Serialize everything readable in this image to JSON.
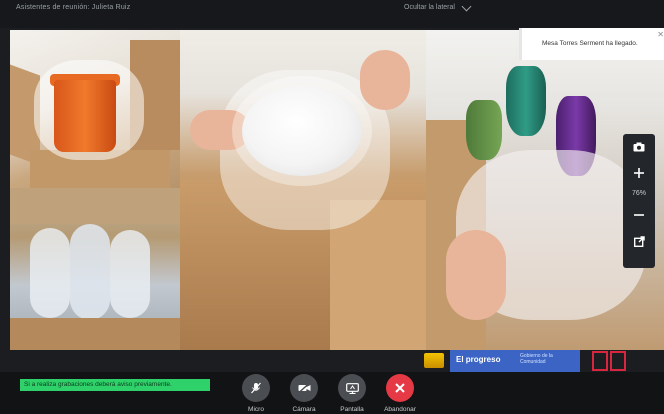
{
  "header": {
    "title": "Asistentes de reunión: Julieta Ruiz",
    "layout_label": "Ocultar la lateral"
  },
  "notification": {
    "message": "Mesa Torres Serment ha llegado."
  },
  "zoom": {
    "level": "76%"
  },
  "branding": {
    "badge_title": "El progreso",
    "badge_subtitle": "Gobierno de la Comunidad"
  },
  "status": {
    "notice": "Si a realiza grabaciones deberá aviso previamente."
  },
  "controls": [
    {
      "label": "Micro",
      "icon": "microphone-off-icon"
    },
    {
      "label": "Cámara",
      "icon": "camera-off-icon"
    },
    {
      "label": "Pantalla",
      "icon": "screen-share-icon"
    },
    {
      "label": "Abandonar",
      "icon": "close-icon"
    }
  ],
  "colors": {
    "accent_green": "#2fd16a",
    "leave_red": "#e53945",
    "badge_blue": "#3b64c5"
  }
}
